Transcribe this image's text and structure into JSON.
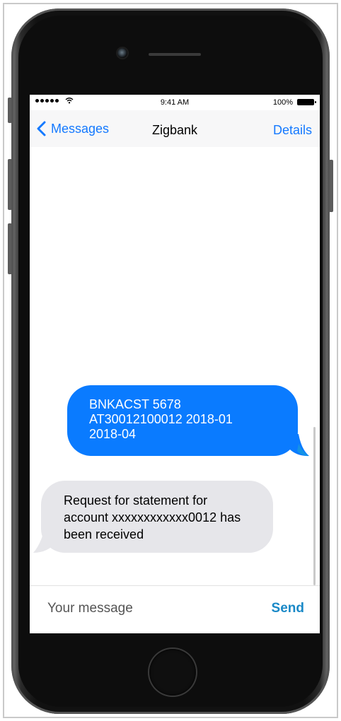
{
  "status_bar": {
    "time": "9:41 AM",
    "battery_percent": "100%",
    "icons": [
      "signal-dots-icon",
      "wifi-icon",
      "battery-icon"
    ]
  },
  "nav": {
    "back_label": "Messages",
    "title": "Zigbank",
    "details_label": "Details"
  },
  "messages": [
    {
      "direction": "outgoing",
      "lines": [
        "BNKACST 5678",
        "AT30012100012 2018-01",
        "2018-04"
      ]
    },
    {
      "direction": "incoming",
      "lines": [
        "Request for statement for",
        "account xxxxxxxxxxxx0012 has",
        "been received"
      ]
    }
  ],
  "composer": {
    "placeholder": "Your message",
    "value": "",
    "send_label": "Send"
  },
  "colors": {
    "outgoing_bubble": "#0a7bff",
    "incoming_bubble": "#e6e6ea",
    "ios_blue": "#1479ff",
    "send": "#1a89c7"
  }
}
